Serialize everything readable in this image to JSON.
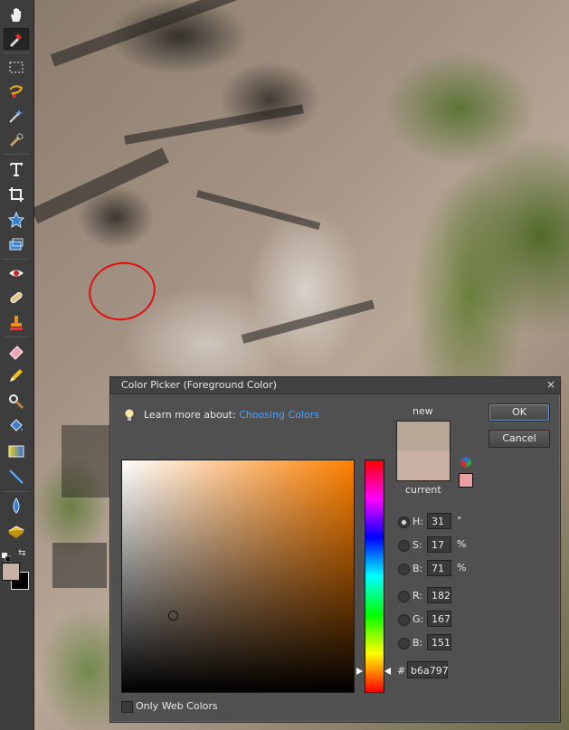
{
  "dialog": {
    "title": "Color Picker (Foreground Color)",
    "close": "×",
    "learn_prefix": "Learn more about:",
    "learn_link": "Choosing Colors",
    "new_label": "new",
    "current_label": "current",
    "ok_label": "OK",
    "cancel_label": "Cancel",
    "web_colors_label": "Only Web Colors",
    "web_colors_checked": false,
    "hex_hash": "#",
    "hex_value": "b6a797"
  },
  "fields": {
    "h": {
      "label": "H:",
      "value": "31",
      "unit": "°"
    },
    "s": {
      "label": "S:",
      "value": "17",
      "unit": "%"
    },
    "b": {
      "label": "B:",
      "value": "71",
      "unit": "%"
    },
    "r": {
      "label": "R:",
      "value": "182"
    },
    "g": {
      "label": "G:",
      "value": "167"
    },
    "blue": {
      "label": "B:",
      "value": "151"
    }
  },
  "colors": {
    "new": "#b6a797",
    "current": "#c8b0a4",
    "gamut_warning": "#e8a0a0",
    "foreground": "#c8b0a4",
    "background": "#000000"
  },
  "icons": [
    "hand-icon",
    "eyedropper-icon",
    "marquee-icon",
    "lasso-icon",
    "magic-wand-icon",
    "quick-selection-icon",
    "type-icon",
    "crop-icon",
    "cookie-cutter-icon",
    "straighten-icon",
    "red-eye-icon",
    "healing-brush-icon",
    "clone-stamp-icon",
    "eraser-icon",
    "pencil-icon",
    "brush-icon",
    "paint-bucket-icon",
    "gradient-icon",
    "line-icon",
    "blur-icon",
    "sponge-icon"
  ]
}
